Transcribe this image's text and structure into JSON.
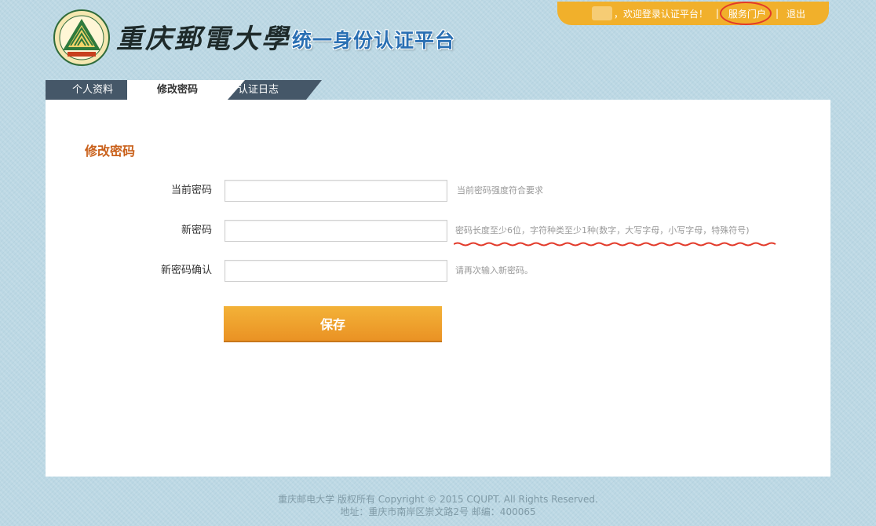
{
  "topbar": {
    "welcome_text": "，欢迎登录认证平台！",
    "separator": "|",
    "portal_link": "服务门户",
    "logout_link": "退出"
  },
  "header": {
    "school_name": "重庆郵電大學",
    "platform_name": "统一身份认证平台"
  },
  "tabs": [
    {
      "label": "个人资料",
      "active": false
    },
    {
      "label": "修改密码",
      "active": true
    },
    {
      "label": "认证日志",
      "active": false
    }
  ],
  "form": {
    "title": "修改密码",
    "fields": [
      {
        "label": "当前密码",
        "value": "",
        "hint": "当前密码强度符合要求"
      },
      {
        "label": "新密码",
        "value": "",
        "hint": "密码长度至少6位，字符种类至少1种(数字，大写字母，小写字母，特殊符号)"
      },
      {
        "label": "新密码确认",
        "value": "",
        "hint": "请再次输入新密码。"
      }
    ],
    "save_label": "保存"
  },
  "footer": {
    "line1": "重庆邮电大学  版权所有 Copyright © 2015 CQUPT. All Rights Reserved.",
    "line2": "地址：重庆市南岸区崇文路2号 邮编：400065"
  },
  "colors": {
    "accent_orange": "#f1b02b",
    "title_orange": "#c9601a",
    "tab_dark": "#455768",
    "platform_blue": "#2a6fb3",
    "annotation_red": "#e23a2a"
  }
}
